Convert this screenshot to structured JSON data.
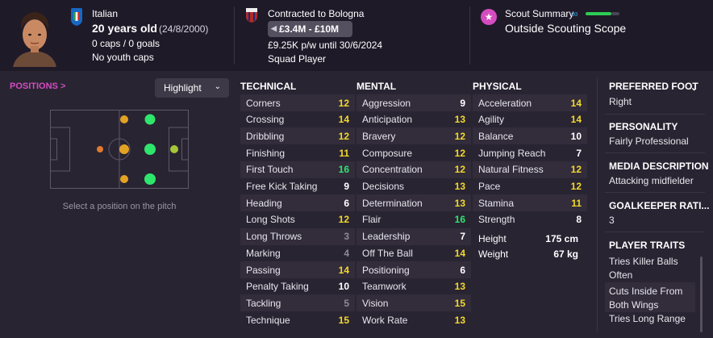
{
  "header": {
    "nationality": "Italian",
    "age": "20 years old",
    "dob": "(24/8/2000)",
    "caps": "0 caps / 0 goals",
    "youth_caps": "No youth caps",
    "contract": "Contracted to Bologna",
    "value": "£3.4M - £10M",
    "wage": "£9.25K p/w until 30/6/2024",
    "squad_status": "Squad Player",
    "scout_label": "Scout Summary",
    "scout_scope": "Outside Scouting Scope",
    "scout_knowledge_percent": 76
  },
  "positions": {
    "title": "POSITIONS >",
    "highlight_label": "Highlight",
    "hint": "Select a position on the pitch",
    "colors": {
      "natural": "#2ee66b",
      "accomplished": "#a5c63a",
      "competent": "#e2a324",
      "unconvincing": "#e07a2e"
    }
  },
  "technical": {
    "title": "TECHNICAL",
    "items": [
      {
        "name": "Corners",
        "value": "12",
        "tone": "yellow"
      },
      {
        "name": "Crossing",
        "value": "14",
        "tone": "yellow"
      },
      {
        "name": "Dribbling",
        "value": "12",
        "tone": "yellow"
      },
      {
        "name": "Finishing",
        "value": "11",
        "tone": "yellow"
      },
      {
        "name": "First Touch",
        "value": "16",
        "tone": "green"
      },
      {
        "name": "Free Kick Taking",
        "value": "9",
        "tone": "white"
      },
      {
        "name": "Heading",
        "value": "6",
        "tone": "white"
      },
      {
        "name": "Long Shots",
        "value": "12",
        "tone": "yellow"
      },
      {
        "name": "Long Throws",
        "value": "3",
        "tone": "grey"
      },
      {
        "name": "Marking",
        "value": "4",
        "tone": "grey"
      },
      {
        "name": "Passing",
        "value": "14",
        "tone": "yellow"
      },
      {
        "name": "Penalty Taking",
        "value": "10",
        "tone": "white"
      },
      {
        "name": "Tackling",
        "value": "5",
        "tone": "grey"
      },
      {
        "name": "Technique",
        "value": "15",
        "tone": "yellow"
      }
    ]
  },
  "mental": {
    "title": "MENTAL",
    "items": [
      {
        "name": "Aggression",
        "value": "9",
        "tone": "white"
      },
      {
        "name": "Anticipation",
        "value": "13",
        "tone": "yellow"
      },
      {
        "name": "Bravery",
        "value": "12",
        "tone": "yellow"
      },
      {
        "name": "Composure",
        "value": "12",
        "tone": "yellow"
      },
      {
        "name": "Concentration",
        "value": "12",
        "tone": "yellow"
      },
      {
        "name": "Decisions",
        "value": "13",
        "tone": "yellow"
      },
      {
        "name": "Determination",
        "value": "13",
        "tone": "yellow"
      },
      {
        "name": "Flair",
        "value": "16",
        "tone": "green"
      },
      {
        "name": "Leadership",
        "value": "7",
        "tone": "white"
      },
      {
        "name": "Off The Ball",
        "value": "14",
        "tone": "yellow"
      },
      {
        "name": "Positioning",
        "value": "6",
        "tone": "white"
      },
      {
        "name": "Teamwork",
        "value": "13",
        "tone": "yellow"
      },
      {
        "name": "Vision",
        "value": "15",
        "tone": "yellow"
      },
      {
        "name": "Work Rate",
        "value": "13",
        "tone": "yellow"
      }
    ]
  },
  "physical": {
    "title": "PHYSICAL",
    "items": [
      {
        "name": "Acceleration",
        "value": "14",
        "tone": "yellow"
      },
      {
        "name": "Agility",
        "value": "14",
        "tone": "yellow"
      },
      {
        "name": "Balance",
        "value": "10",
        "tone": "white"
      },
      {
        "name": "Jumping Reach",
        "value": "7",
        "tone": "white"
      },
      {
        "name": "Natural Fitness",
        "value": "12",
        "tone": "yellow"
      },
      {
        "name": "Pace",
        "value": "12",
        "tone": "yellow"
      },
      {
        "name": "Stamina",
        "value": "11",
        "tone": "yellow"
      },
      {
        "name": "Strength",
        "value": "8",
        "tone": "white"
      }
    ],
    "height_label": "Height",
    "height": "175 cm",
    "weight_label": "Weight",
    "weight": "67 kg"
  },
  "info": {
    "preferred_foot_title": "PREFERRED FOOT",
    "preferred_foot": "Right",
    "personality_title": "PERSONALITY",
    "personality": "Fairly Professional",
    "media_title": "MEDIA DESCRIPTION",
    "media": "Attacking midfielder",
    "gk_title": "GOALKEEPER RATI...",
    "gk": "3",
    "traits_title": "PLAYER TRAITS",
    "traits": [
      "Tries Killer Balls Often",
      "Cuts Inside From Both Wings",
      "Tries Long Range"
    ]
  }
}
